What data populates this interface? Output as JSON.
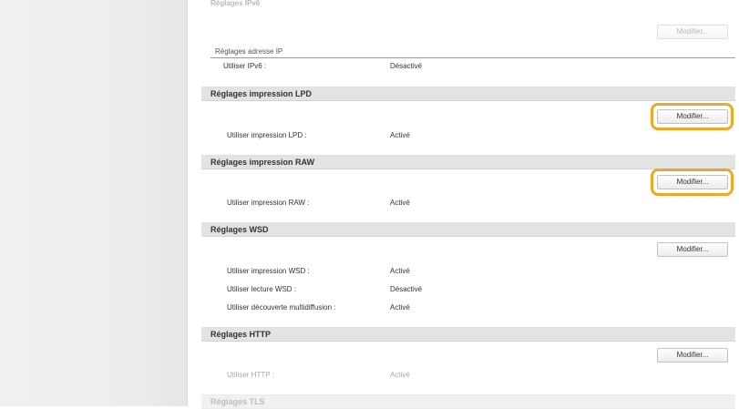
{
  "ipv6": {
    "header_faded": "Réglages IPv6",
    "edit_label": "Modifier...",
    "address_label": "Réglages adresse IP",
    "use_ipv6_label": "Utiliser IPv6 :",
    "use_ipv6_value": "Désactivé"
  },
  "lpd": {
    "title": "Réglages impression LPD",
    "edit_label": "Modifier...",
    "use_lpd_label": "Utiliser impression LPD :",
    "use_lpd_value": "Activé"
  },
  "raw": {
    "title": "Réglages impression RAW",
    "edit_label": "Modifier...",
    "use_raw_label": "Utiliser impression RAW :",
    "use_raw_value": "Activé"
  },
  "wsd": {
    "title": "Réglages WSD",
    "edit_label": "Modifier...",
    "rows": [
      {
        "label": "Utiliser impression WSD :",
        "value": "Activé"
      },
      {
        "label": "Utiliser lecture WSD :",
        "value": "Désactivé"
      },
      {
        "label": "Utiliser découverte multidiffusion :",
        "value": "Activé"
      }
    ]
  },
  "http": {
    "title": "Réglages HTTP",
    "edit_label": "Modifier...",
    "use_http_label": "Utiliser HTTP :",
    "use_http_value": "Activé"
  },
  "tls": {
    "header_faded": "Réglages TLS"
  },
  "colors": {
    "highlight": "#f2a626",
    "section_header_bg": "#e3e3e3",
    "sidebar_bg": "#efefef"
  }
}
